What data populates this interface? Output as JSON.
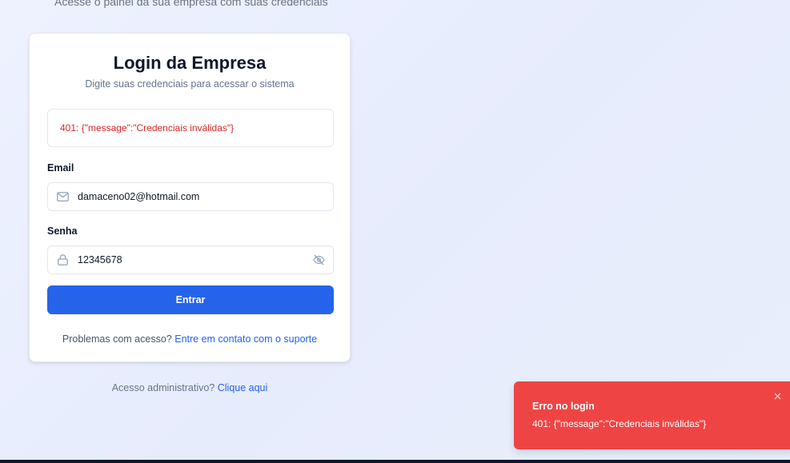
{
  "page": {
    "top_subtitle": "Acesse o painel da sua empresa com suas credenciais"
  },
  "card": {
    "title": "Login da Empresa",
    "subtitle": "Digite suas credenciais para acessar o sistema",
    "error_message": "401: {\"message\":\"Credenciais inválidas\"}",
    "email": {
      "label": "Email",
      "value": "damaceno02@hotmail.com",
      "icon": "mail-icon"
    },
    "password": {
      "label": "Senha",
      "value": "12345678",
      "icon": "lock-icon",
      "toggle_icon": "eye-off-icon"
    },
    "submit_label": "Entrar",
    "help": {
      "text": "Problemas com acesso?",
      "link": "Entre em contato com o suporte"
    }
  },
  "admin": {
    "text": "Acesso administrativo?",
    "link": "Clique aqui"
  },
  "toast": {
    "title": "Erro no login",
    "message": "401: {\"message\":\"Credenciais inválidas\"}",
    "close_icon": "close-icon"
  },
  "colors": {
    "primary": "#2563eb",
    "error": "#dc2626",
    "toast_bg": "#ef4444"
  }
}
